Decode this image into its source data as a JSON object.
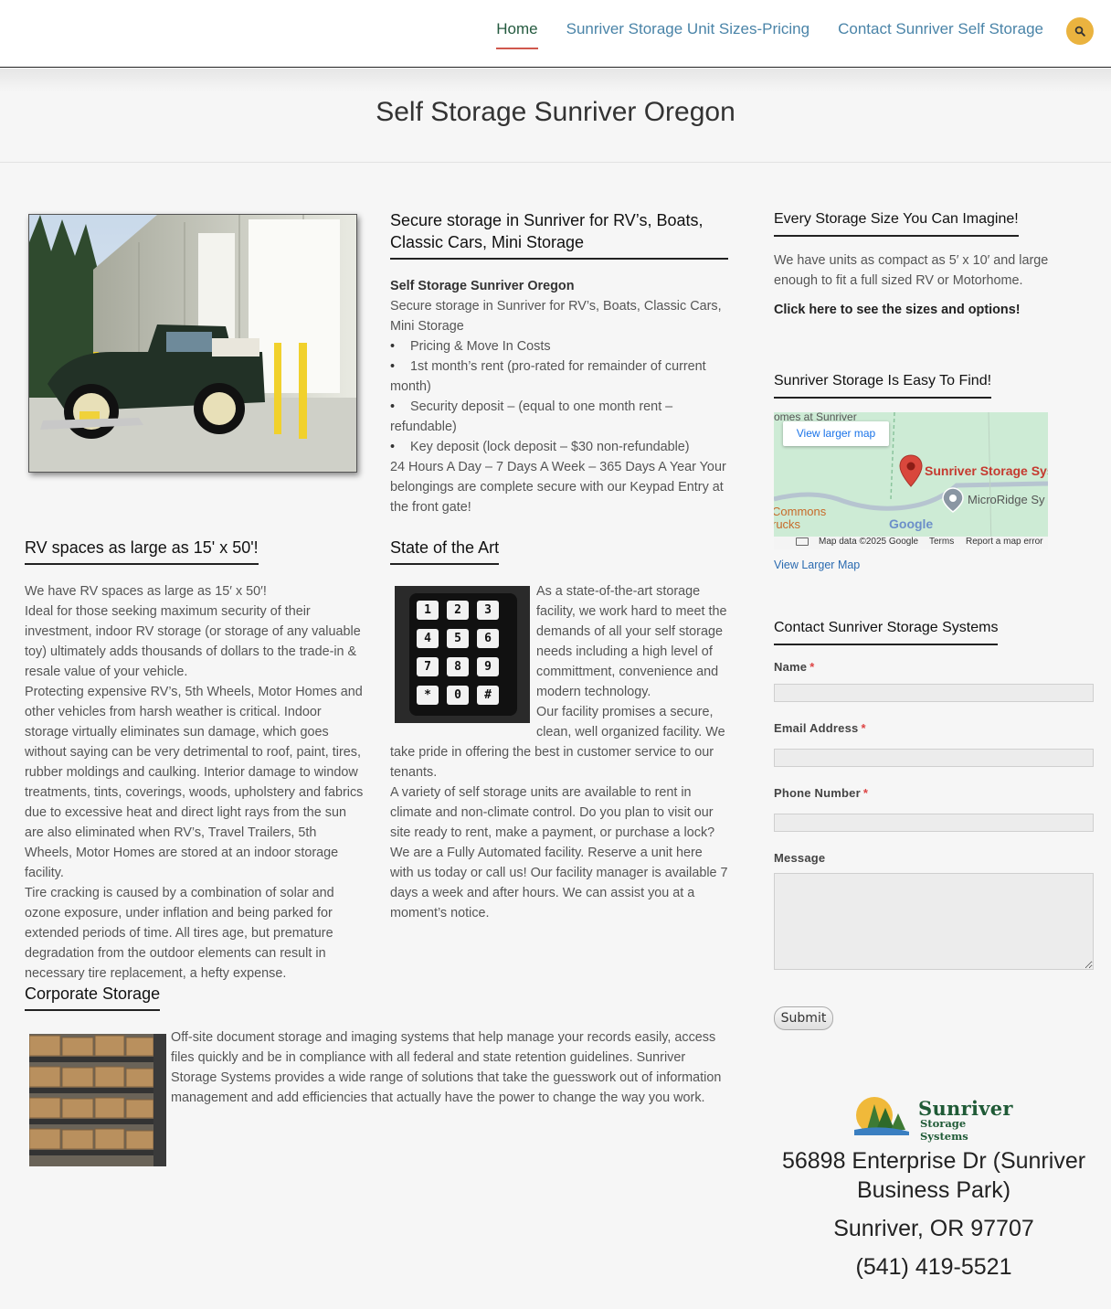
{
  "nav": {
    "items": [
      {
        "label": "Home",
        "active": true
      },
      {
        "label": "Sunriver Storage Unit Sizes-Pricing",
        "active": false
      },
      {
        "label": "Contact Sunriver Self Storage",
        "active": false
      }
    ],
    "search_icon": "search-icon"
  },
  "page": {
    "title": "Self Storage Sunriver Oregon"
  },
  "intro": {
    "heading": "Secure storage in Sunriver for RV’s, Boats, Classic Cars, Mini Storage",
    "bold": "Self Storage Sunriver Oregon",
    "line1": "Secure storage in Sunriver for RV’s, Boats, Classic Cars, Mini Storage",
    "bullets": [
      "Pricing & Move In Costs",
      "1st month’s rent (pro-rated for remainder of current month)",
      "Security deposit – (equal to one month rent – refundable)",
      "Key deposit (lock deposit – $30 non-refundable)"
    ],
    "closing": "24 Hours A Day – 7 Days A Week – 365 Days A Year Your belongings are complete secure with our Keypad Entry at the front gate!"
  },
  "rv": {
    "heading": "RV spaces as large as 15' x 50'!",
    "p1": "We have RV spaces as large as 15′ x 50′!",
    "p2": "Ideal for those seeking maximum security of their investment, indoor RV storage (or storage of any valuable toy) ultimately adds thousands of dollars to the trade-in & resale value of your vehicle.",
    "p3": "Protecting expensive RV’s, 5th Wheels, Motor Homes and other vehicles from harsh weather is critical. Indoor storage virtually eliminates sun damage, which goes without saying can be very detrimental to roof, paint, tires, rubber moldings and caulking. Interior damage to window treatments, tints, coverings, woods, upholstery and fabrics due to excessive heat and direct light rays from the sun are also eliminated when RV’s, Travel Trailers, 5th Wheels, Motor Homes are stored at an indoor storage facility.",
    "p4": "Tire cracking is caused by a combination of solar and ozone exposure, under inflation and being parked for extended periods of time. All tires age, but premature degradation from the outdoor elements can result in necessary tire replacement, a hefty expense."
  },
  "art": {
    "heading": "State of the Art",
    "p1": "As a state-of-the-art storage facility, we work hard to meet the demands of all your self storage needs including a high level of committment, convenience and modern technology.",
    "p2": "Our facility promises a secure, clean, well organized facility.  We take pride in offering the best in customer service to our tenants.",
    "p3": "A variety of self storage units are available to rent in climate and non-climate control.  Do you plan to visit our site ready to rent, make a payment, or purchase a lock?",
    "p4": "We are a Fully Automated facility.  Reserve a unit here with us today or call us!  Our facility manager is available 7 days a week and after hours.  We can assist you at a moment’s notice.",
    "keys": [
      "1",
      "2",
      "3",
      "4",
      "5",
      "6",
      "7",
      "8",
      "9",
      "*",
      "0",
      "#"
    ]
  },
  "corporate": {
    "heading": "Corporate Storage",
    "text": "Off-site document storage and imaging systems that help manage your records easily, access files quickly and be in compliance with all federal and state retention guidelines. Sunriver Storage Systems provides a wide range of solutions that take the guesswork out of information management and add efficiencies that actually have the power to change the way you work."
  },
  "sidebar": {
    "sizes_heading": "Every Storage Size You Can Imagine!",
    "sizes_text": "We have units as compact as 5′ x 10′ and large enough to fit a full sized RV or Motorhome.",
    "sizes_link": "Click here to see the sizes and options!",
    "find_heading": "Sunriver Storage Is Easy To Find!",
    "map": {
      "view_larger_button": "View larger map",
      "top_label": "omes at Sunriver",
      "pin_label": "Sunriver Storage Syste",
      "poi_label": "MicroRidge Sy",
      "left_label_1": "Commons",
      "left_label_2": "rucks",
      "google": "Google",
      "map_data": "Map data ©2025 Google",
      "terms": "Terms",
      "report": "Report a map error"
    },
    "view_larger_link": "View Larger Map",
    "contact_heading": "Contact Sunriver Storage Systems",
    "form": {
      "name_label": "Name",
      "email_label": "Email Address",
      "phone_label": "Phone Number",
      "message_label": "Message",
      "required_mark": "*",
      "submit": "Submit"
    },
    "logo": {
      "line1": "Sunriver",
      "line2": "Storage Systems"
    },
    "address_line1": "56898 Enterprise Dr (Sunriver Business Park)",
    "address_line2": "Sunriver, OR 97707",
    "phone": "(541) 419-5521"
  },
  "colors": {
    "link": "#4a84a8",
    "nav_active": "#245a3f",
    "nav_underline": "#d0584d",
    "search_button": "#eab33f",
    "map_pin": "#d9473c"
  }
}
